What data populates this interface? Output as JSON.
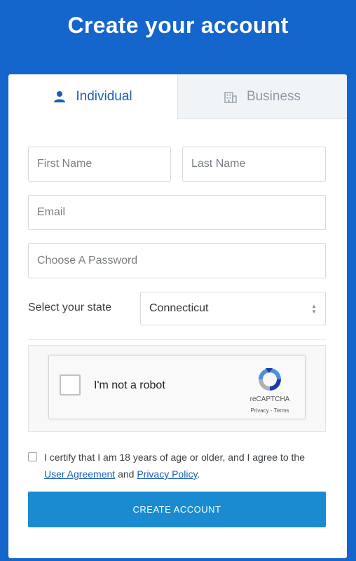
{
  "page": {
    "title": "Create your account"
  },
  "tabs": {
    "individual": {
      "label": "Individual",
      "icon": "person-icon"
    },
    "business": {
      "label": "Business",
      "icon": "building-icon"
    }
  },
  "form": {
    "first_name_placeholder": "First Name",
    "last_name_placeholder": "Last Name",
    "email_placeholder": "Email",
    "password_placeholder": "Choose A Password",
    "state_label": "Select your state",
    "state_value": "Connecticut"
  },
  "captcha": {
    "label": "I'm not a robot",
    "brand": "reCAPTCHA",
    "links": "Privacy - Terms"
  },
  "agreement": {
    "text_before": "I certify that I am 18 years of age or older, and I agree to the",
    "user_agreement_link": "User Agreement",
    "and": "and",
    "privacy_link": "Privacy Policy",
    "period": "."
  },
  "submit": {
    "label": "CREATE ACCOUNT"
  },
  "colors": {
    "background": "#1465cc",
    "accent_tab": "#1d5fae",
    "button": "#1a8bd1",
    "link": "#1a5fb4"
  }
}
